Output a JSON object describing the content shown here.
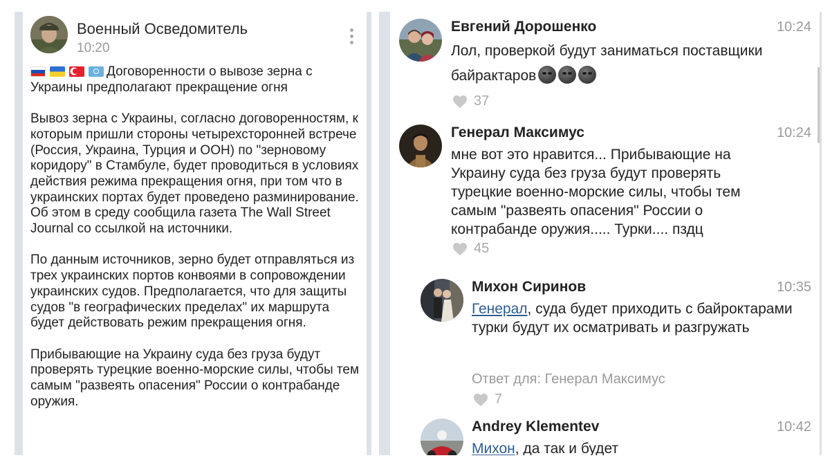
{
  "post": {
    "channel_name": "Военный Осведомитель",
    "time": "10:20",
    "flags": [
      "flag-russia",
      "flag-ukraine",
      "flag-turkey",
      "flag-un"
    ],
    "headline": "Договоренности о вывозе зерна с Украины предполагают прекращение огня",
    "paragraph1": "Вывоз зерна с Украины, согласно договоренностям, к которым пришли стороны четырехсторонней встрече (Россия, Украина, Турция и ООН) по \"зерновому коридору\" в Стамбуле, будет проводиться в условиях действия режима прекращения огня, при том что в украинских портах будет проведено разминирование. Об этом в среду сообщила газета The Wall Street Journal со ссылкой на источники.",
    "paragraph2": "По данным источников, зерно будет отправляться из трех украинских портов конвоями в сопровождении украинских судов. Предполагается, что для защиты судов \"в географических пределах\" их маршрута будет действовать режим прекращения огня.",
    "paragraph3": "Прибывающие на Украину суда без груза будут проверять турецкие военно-морские силы, чтобы тем самым \"развеять опасения\" России о контрабанде оружия."
  },
  "comments": [
    {
      "author": "Евгений Дорошенко",
      "time": "10:24",
      "text": "Лол, проверкой будут заниматься поставщики байрактаров",
      "emoji": [
        "new-moon-face-emoji",
        "new-moon-face-emoji",
        "new-moon-face-emoji"
      ],
      "likes": "37"
    },
    {
      "author": "Генерал Максимус",
      "time": "10:24",
      "text": "мне вот это нравится... Прибывающие на Украину суда без груза будут проверять турецкие военно-морские силы, чтобы тем самым \"развеять опасения\" России о контрабанде оружия..... Турки.... пздц",
      "likes": "45"
    },
    {
      "author": "Михон Сиринов",
      "time": "10:35",
      "mention": "Генерал",
      "text": ", суда будет приходить с байроктарами турки будут их осматривать и разгружать",
      "reply_to": "Ответ для: Генерал Максимус",
      "likes": "7"
    },
    {
      "author": "Andrey Klementev",
      "time": "10:42",
      "mention": "Михон",
      "text": ", да так и будет"
    }
  ],
  "colors": {
    "panel_background": "#dde1e8",
    "mention_link": "#2f5d8f",
    "muted_text": "#9a9a9a"
  }
}
